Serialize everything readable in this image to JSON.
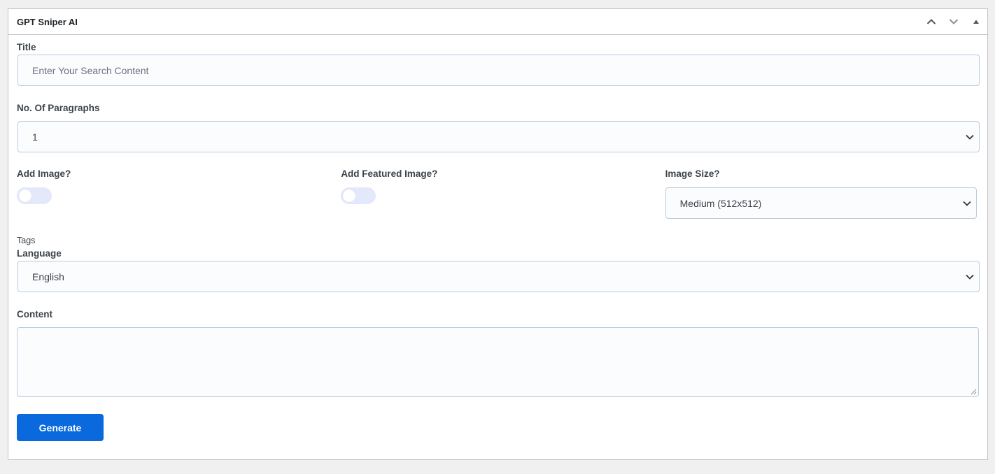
{
  "panel": {
    "title": "GPT Sniper AI",
    "actions": [
      "move-up-icon",
      "move-down-icon",
      "toggle-panel-icon"
    ]
  },
  "form": {
    "title_label": "Title",
    "title_placeholder": "Enter Your Search Content",
    "paragraphs_label": "No. Of Paragraphs",
    "paragraphs_value": "1",
    "add_image_label": "Add Image?",
    "add_image_on": false,
    "add_featured_label": "Add Featured Image?",
    "add_featured_on": false,
    "image_size_label": "Image Size?",
    "image_size_value": "Medium (512x512)",
    "tags_label": "Tags",
    "language_label": "Language",
    "language_value": "English",
    "content_label": "Content",
    "content_value": "",
    "generate_label": "Generate"
  },
  "colors": {
    "accent": "#0a69dd",
    "toggle_off": "#e3e8fb",
    "field_border": "#b9cbe0"
  }
}
